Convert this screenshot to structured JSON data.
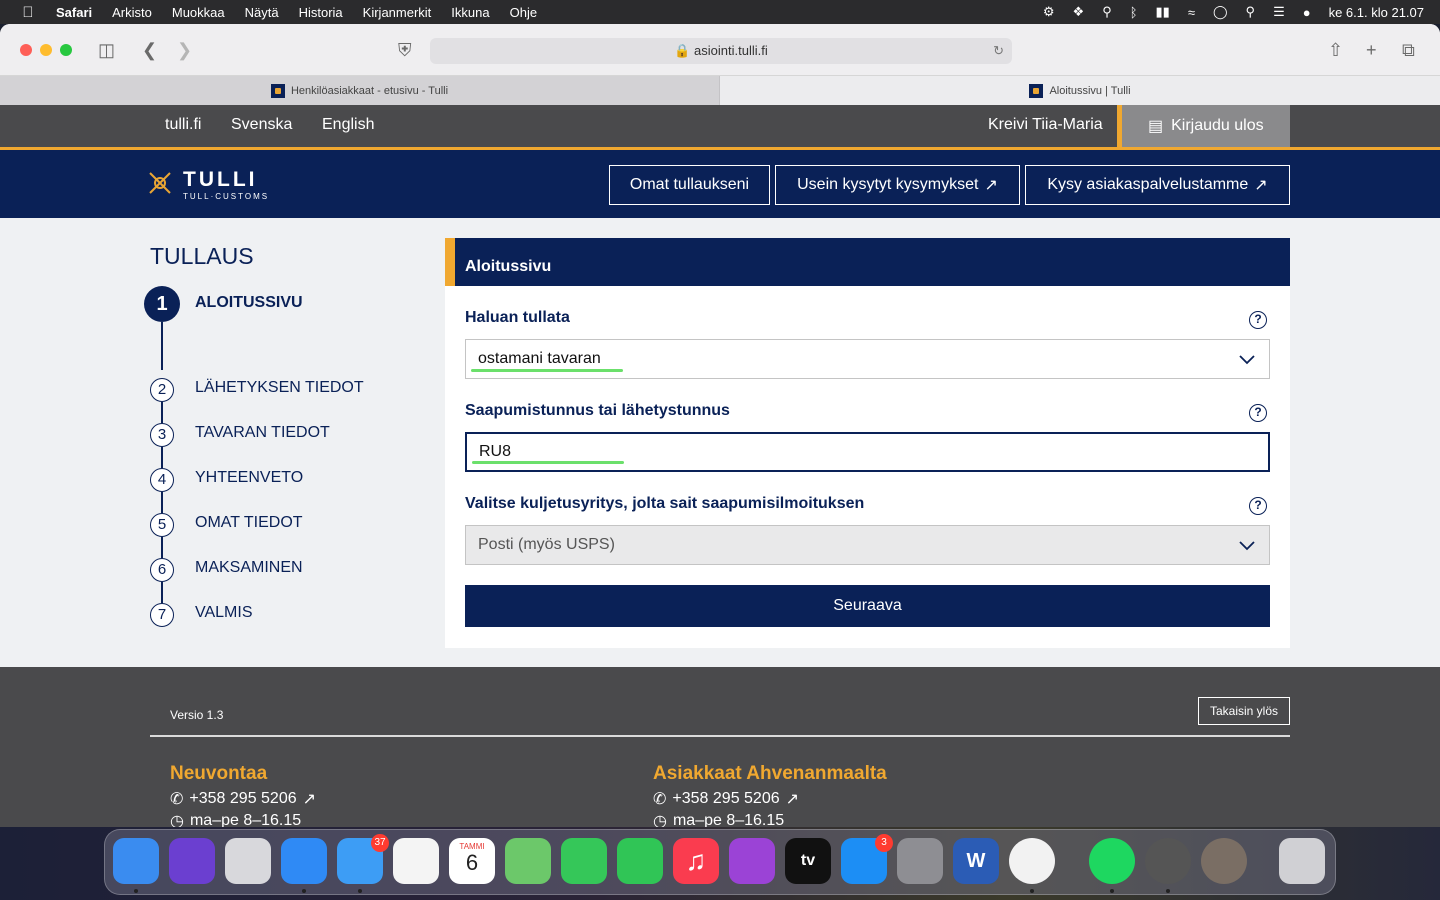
{
  "menubar": {
    "app": "Safari",
    "items": [
      "Arkisto",
      "Muokkaa",
      "Näytä",
      "Historia",
      "Kirjanmerkit",
      "Ikkuna",
      "Ohje"
    ],
    "clock": "ke 6.1. klo  21.07"
  },
  "browser": {
    "url": "asiointi.tulli.fi",
    "tabs": [
      {
        "title": "Henkilöasiakkaat - etusivu - Tulli"
      },
      {
        "title": "Aloitussivu | Tulli"
      }
    ]
  },
  "topnav": {
    "links": [
      "tulli.fi",
      "Svenska",
      "English"
    ],
    "user": "Kreivi Tiia-Maria",
    "logout": "Kirjaudu ulos"
  },
  "header": {
    "logo_title": "TULLI",
    "logo_sub": "TULL·CUSTOMS",
    "buttons": [
      "Omat tullaukseni",
      "Usein kysytyt kysymykset",
      "Kysy asiakaspalvelustamme"
    ]
  },
  "sidebar": {
    "title": "TULLAUS",
    "steps": [
      {
        "num": "1",
        "label": "ALOITUSSIVU"
      },
      {
        "num": "2",
        "label": "LÄHETYKSEN TIEDOT"
      },
      {
        "num": "3",
        "label": "TAVARAN TIEDOT"
      },
      {
        "num": "4",
        "label": "YHTEENVETO"
      },
      {
        "num": "5",
        "label": "OMAT TIEDOT"
      },
      {
        "num": "6",
        "label": "MAKSAMINEN"
      },
      {
        "num": "7",
        "label": "VALMIS"
      }
    ]
  },
  "form": {
    "heading": "Aloitussivu",
    "fields": [
      {
        "label": "Haluan tullata",
        "value": "ostamani tavaran"
      },
      {
        "label": "Saapumistunnus tai lähetystunnus",
        "value": "RU8"
      },
      {
        "label": "Valitse kuljetusyritys, jolta sait saapumisilmoituksen",
        "value": "Posti (myös USPS)"
      }
    ],
    "help": "?",
    "submit": "Seuraava"
  },
  "footer": {
    "version": "Versio 1.3",
    "back_to_top": "Takaisin ylös",
    "columns": [
      {
        "title": "Neuvontaa",
        "phone": "+358 295 5206",
        "hours": "ma–pe 8–16.15"
      },
      {
        "title": "Asiakkaat Ahvenanmaalta",
        "phone": "+358 295 5206",
        "hours": "ma–pe 8–16.15"
      }
    ]
  },
  "dock": {
    "apps": [
      {
        "name": "Finder",
        "color": "#3a8cf0"
      },
      {
        "name": "Siri",
        "color": "#6b3fd0"
      },
      {
        "name": "Launchpad",
        "color": "#d8d8dc"
      },
      {
        "name": "Safari",
        "color": "#2f8af5"
      },
      {
        "name": "Mail",
        "color": "#3d9df5",
        "badge": "37"
      },
      {
        "name": "Photos",
        "color": "#f4f4f4"
      },
      {
        "name": "Calendar",
        "color": "#ffffff",
        "month": "TAMMI",
        "day": "6"
      },
      {
        "name": "Maps",
        "color": "#6cc86a"
      },
      {
        "name": "Messages",
        "color": "#35c759"
      },
      {
        "name": "FaceTime",
        "color": "#30c556"
      },
      {
        "name": "Music",
        "color": "#fa3c4f"
      },
      {
        "name": "Podcasts",
        "color": "#9b43d6"
      },
      {
        "name": "TV",
        "color": "#111111",
        "label": "tv"
      },
      {
        "name": "App Store",
        "color": "#1c8ef5",
        "badge": "3"
      },
      {
        "name": "System Preferences",
        "color": "#8e8e93"
      },
      {
        "name": "Word",
        "color": "#2b5cb5",
        "label": "W"
      },
      {
        "name": "Chrome",
        "color": "#f2f2f2"
      },
      {
        "name": "Spotify",
        "color": "#1ed760"
      },
      {
        "name": "Activity",
        "color": "#555555"
      },
      {
        "name": "Preview",
        "color": "#7a6e64"
      },
      {
        "name": "Trash",
        "color": "#d0d0d4"
      }
    ]
  }
}
